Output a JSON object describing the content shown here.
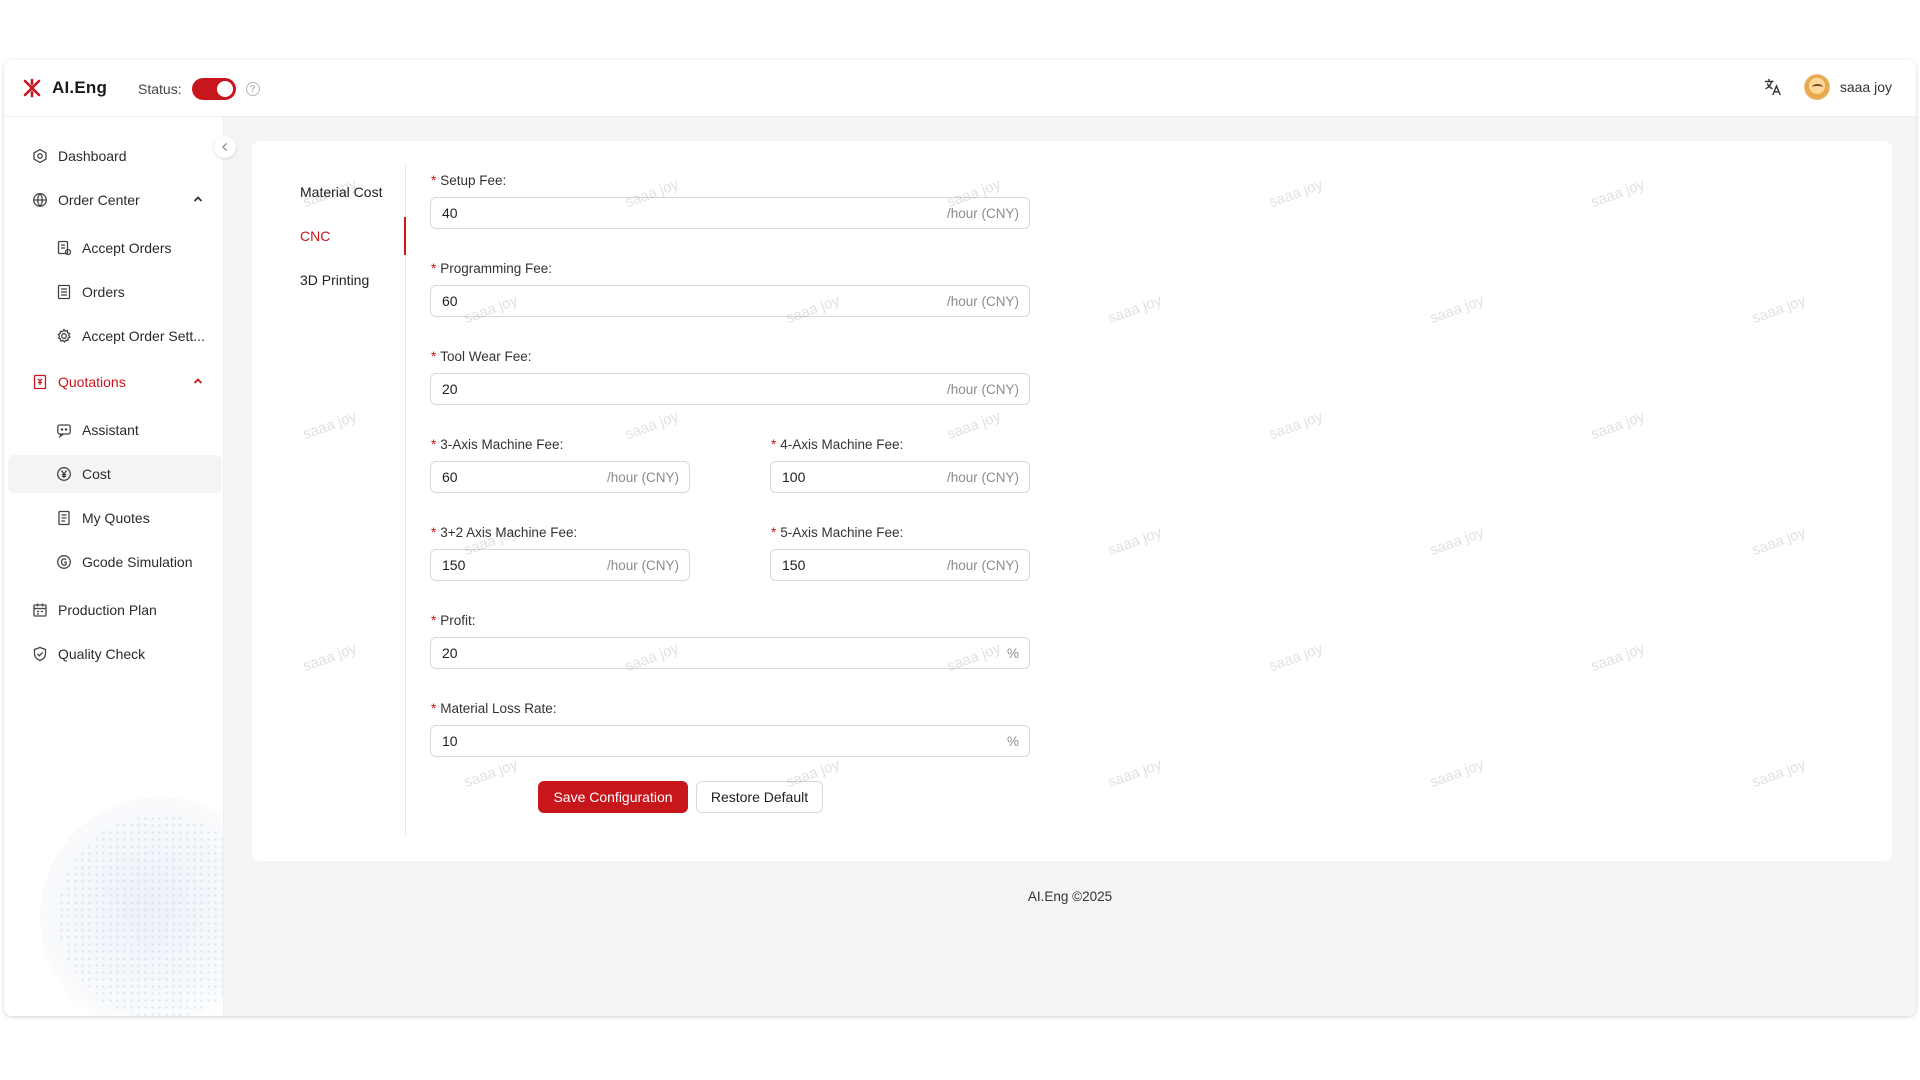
{
  "header": {
    "app_name": "AI.Eng",
    "status_label": "Status:",
    "status_on": true,
    "user_name": "saaa joy",
    "icons": {
      "logo": "logo-icon",
      "help": "help-icon",
      "translate": "translate-icon"
    }
  },
  "sidebar": {
    "items": [
      {
        "label": "Dashboard",
        "icon": "dashboard-icon"
      },
      {
        "label": "Order Center",
        "icon": "globe-icon",
        "expanded": true
      },
      {
        "label": "Accept Orders",
        "icon": "file-icon"
      },
      {
        "label": "Orders",
        "icon": "list-icon"
      },
      {
        "label": "Accept Order Sett...",
        "icon": "gear-icon"
      },
      {
        "label": "Quotations",
        "icon": "quote-icon",
        "expanded": true
      },
      {
        "label": "Assistant",
        "icon": "chat-icon"
      },
      {
        "label": "Cost",
        "icon": "yen-icon"
      },
      {
        "label": "My Quotes",
        "icon": "doc-icon"
      },
      {
        "label": "Gcode Simulation",
        "icon": "code-icon"
      },
      {
        "label": "Production Plan",
        "icon": "calendar-icon"
      },
      {
        "label": "Quality Check",
        "icon": "shield-icon"
      }
    ]
  },
  "tabs": [
    {
      "label": "Material Cost"
    },
    {
      "label": "CNC"
    },
    {
      "label": "3D Printing"
    }
  ],
  "form": {
    "setup_fee": {
      "label": "Setup Fee:",
      "value": "40",
      "suffix": "/hour (CNY)"
    },
    "programming_fee": {
      "label": "Programming Fee:",
      "value": "60",
      "suffix": "/hour (CNY)"
    },
    "tool_wear_fee": {
      "label": "Tool Wear Fee:",
      "value": "20",
      "suffix": "/hour (CNY)"
    },
    "axis3_fee": {
      "label": "3-Axis Machine Fee:",
      "value": "60",
      "suffix": "/hour (CNY)"
    },
    "axis4_fee": {
      "label": "4-Axis Machine Fee:",
      "value": "100",
      "suffix": "/hour (CNY)"
    },
    "axis32_fee": {
      "label": "3+2 Axis Machine Fee:",
      "value": "150",
      "suffix": "/hour (CNY)"
    },
    "axis5_fee": {
      "label": "5-Axis Machine Fee:",
      "value": "150",
      "suffix": "/hour (CNY)"
    },
    "profit": {
      "label": "Profit:",
      "value": "20",
      "suffix": "%"
    },
    "material_loss": {
      "label": "Material Loss Rate:",
      "value": "10",
      "suffix": "%"
    },
    "required_mark": "*",
    "save_label": "Save Configuration",
    "restore_label": "Restore Default"
  },
  "watermark_text": "saaa joy",
  "footer": {
    "text": "AI.Eng ©2025"
  },
  "colors": {
    "accent": "#c8161d"
  }
}
